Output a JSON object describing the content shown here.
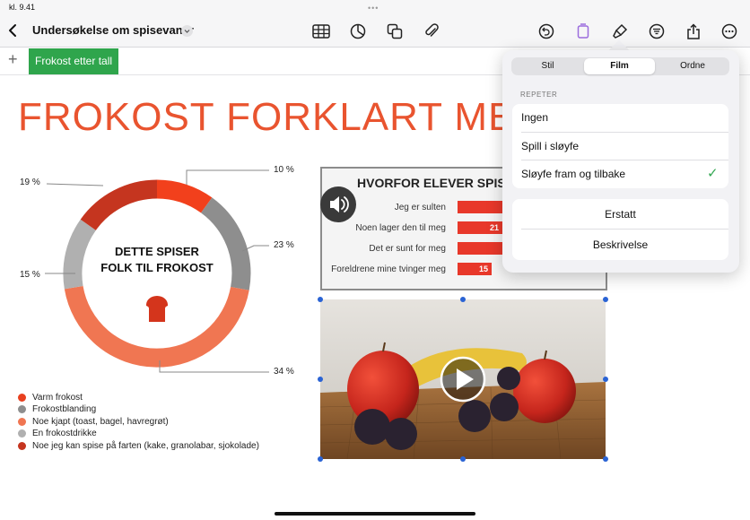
{
  "status": {
    "time": "kl. 9.41"
  },
  "toolbar": {
    "title": "Undersøkelse om spisevaner",
    "left_icons": [
      "back-chevron-icon",
      "title-dropdown-icon"
    ],
    "center_icons": [
      "table-icon",
      "chart-icon",
      "shapes-icon",
      "paperclip-icon"
    ],
    "right_icons": [
      "undo-icon",
      "document-icon",
      "paintbrush-icon",
      "filter-icon",
      "share-icon",
      "more-icon"
    ],
    "dots": "•••"
  },
  "sheets": {
    "add": "+",
    "active_tab": "Frokost etter tall"
  },
  "slide": {
    "title": "FROKOST FORKLART MED"
  },
  "donut": {
    "center_line1": "DETTE SPISER",
    "center_line2": "FOLK TIL FROKOST",
    "labels": {
      "top_right": "10 %",
      "right": "23 %",
      "bottom_right": "34 %",
      "left": "15 %",
      "top_left": "19 %"
    },
    "legend": [
      {
        "label": "Varm frokost",
        "color": "#e8401f"
      },
      {
        "label": "Frokostblanding",
        "color": "#8e8e8e"
      },
      {
        "label": "Noe kjapt (toast, bagel, havregrøt)",
        "color": "#f07652"
      },
      {
        "label": "En frokostdrikke",
        "color": "#b0b0b0"
      },
      {
        "label": "Noe jeg kan spise på farten (kake, granolabar, sjokolade)",
        "color": "#c5351f"
      }
    ]
  },
  "bar_chart": {
    "title": "HVORFOR ELEVER SPISE",
    "rows": [
      {
        "label": "Jeg er sulten",
        "value": ""
      },
      {
        "label": "Noen lager den til meg",
        "value": "21"
      },
      {
        "label": "Det er sunt for meg",
        "value": ""
      },
      {
        "label": "Foreldrene mine tvinger meg",
        "value": "15"
      }
    ]
  },
  "popover": {
    "tabs": [
      "Stil",
      "Film",
      "Ordne"
    ],
    "active_tab": "Film",
    "repeat_header": "REPETER",
    "repeat_options": [
      "Ingen",
      "Spill i sløyfe",
      "Sløyfe fram og tilbake"
    ],
    "selected_option": "Sløyfe fram og tilbake",
    "check": "✓",
    "actions": [
      "Erstatt",
      "Beskrivelse"
    ]
  },
  "colors": {
    "accent_green": "#2fa54c",
    "title_orange": "#e9542f",
    "popover_purple": "#9b6cdd",
    "check_green": "#34a853"
  }
}
